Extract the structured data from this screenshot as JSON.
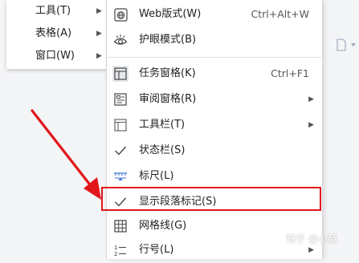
{
  "left_menu": {
    "items": [
      {
        "label": "工具(T)"
      },
      {
        "label": "表格(A)"
      },
      {
        "label": "窗口(W)"
      }
    ]
  },
  "main_menu": {
    "items": [
      {
        "label": "Web版式(W)",
        "shortcut": "Ctrl+Alt+W",
        "icon": "globe-icon"
      },
      {
        "label": "护眼模式(B)",
        "icon": "eye-icon"
      },
      {
        "label": "任务窗格(K)",
        "shortcut": "Ctrl+F1",
        "icon": "task-pane-icon",
        "active": true
      },
      {
        "label": "审阅窗格(R)",
        "submenu": true,
        "icon": "review-pane-icon"
      },
      {
        "label": "工具栏(T)",
        "submenu": true,
        "icon": "toolbar-icon"
      },
      {
        "label": "状态栏(S)",
        "checked": true
      },
      {
        "label": "标尺(L)",
        "icon": "ruler-icon"
      },
      {
        "label": "显示段落标记(S)",
        "checked": true,
        "highlighted": true
      },
      {
        "label": "网格线(G)",
        "icon": "grid-icon"
      },
      {
        "label": "行号(L)",
        "submenu": true,
        "icon": "line-number-icon"
      }
    ]
  },
  "watermark": "知乎 @小慧",
  "colors": {
    "highlight": "#e0161b",
    "accent_blue": "#3b6fd6"
  }
}
